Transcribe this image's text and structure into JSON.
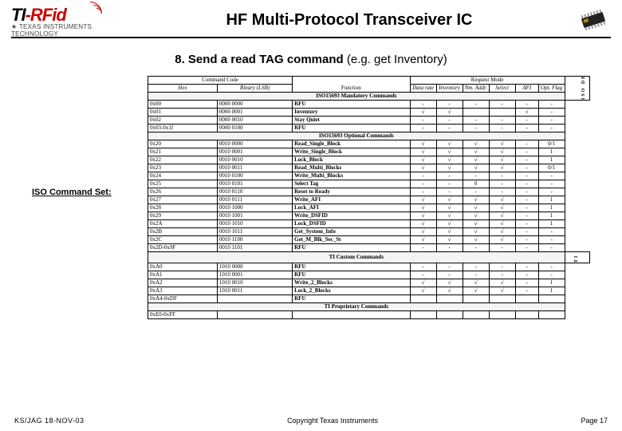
{
  "logo": {
    "ti": "TI",
    "rfid": "-RFid",
    "sub": "★ TEXAS INSTRUMENTS TECHNOLOGY"
  },
  "title": "HF Multi-Protocol Transceiver IC",
  "subtitle_bold": "8. Send a read TAG command ",
  "subtitle_norm": "(e.g. get Inventory)",
  "side_label": "ISO Command Set:",
  "headers": {
    "cmd": "Command Code",
    "func": "Function",
    "req": "Request Mode",
    "hex": "Hex",
    "bin": "Binary (LSB)",
    "dr": "Data rate",
    "inv": "Inventory",
    "addr": "Nm. Addr.",
    "sel": "Select",
    "afi": "AFI",
    "opt": "Opt. Flag"
  },
  "sections": {
    "s1": "ISO15693 Mandatory Commands",
    "s2": "ISO15693 Optional Commands",
    "s3": "TI Custom Commands",
    "s4": "TI Proprietary Commands"
  },
  "vside": {
    "a": "ISO DEFINED",
    "b": "COMMANDS",
    "c": "TI CMDS"
  },
  "rows_mand": [
    {
      "h": "0x00",
      "b": "0000 0000",
      "f": "RFU",
      "d": "-",
      "i": "-",
      "a": "-",
      "s": "-",
      "af": "-",
      "o": "-"
    },
    {
      "h": "0x01",
      "b": "0000 0001",
      "f": "Inventory",
      "d": "√",
      "i": "√",
      "a": "",
      "s": "",
      "af": "√",
      "o": "-"
    },
    {
      "h": "0x02",
      "b": "0000 0010",
      "f": "Stay Quiet",
      "d": "-",
      "i": "-",
      "a": "-",
      "s": "-",
      "af": "-",
      "o": "-"
    },
    {
      "h": "0x03-0x1f",
      "b": "0000 0100",
      "f": "RFU",
      "d": "-",
      "i": "-",
      "a": "-",
      "s": "-",
      "af": "-",
      "o": "-"
    }
  ],
  "rows_opt": [
    {
      "h": "0x20",
      "b": "0010 0000",
      "f": "Read_Single_Block",
      "d": "√",
      "i": "√",
      "a": "√",
      "s": "√",
      "af": "-",
      "o": "0/1"
    },
    {
      "h": "0x21",
      "b": "0010 0001",
      "f": "Write_Single_Block",
      "d": "√",
      "i": "√",
      "a": "√",
      "s": "√",
      "af": "-",
      "o": "1"
    },
    {
      "h": "0x22",
      "b": "0010 0010",
      "f": "Lock_Block",
      "d": "√",
      "i": "√",
      "a": "√",
      "s": "√",
      "af": "-",
      "o": "1"
    },
    {
      "h": "0x23",
      "b": "0010 0011",
      "f": "Read_Multi_Blocks",
      "d": "√",
      "i": "√",
      "a": "√",
      "s": "√",
      "af": "-",
      "o": "0/1"
    },
    {
      "h": "0x24",
      "b": "0010 0100",
      "f": "Write_Multi_Blocks",
      "d": "-",
      "i": "-",
      "a": "-",
      "s": "-",
      "af": "-",
      "o": "-"
    },
    {
      "h": "0x25",
      "b": "0010 0101",
      "f": "Select Tag",
      "d": "-",
      "i": "-",
      "a": "0",
      "s": "-",
      "af": "-",
      "o": "-"
    },
    {
      "h": "0x26",
      "b": "0010 0110",
      "f": "Reset to Ready",
      "d": "-",
      "i": "-",
      "a": "-",
      "s": "-",
      "af": "-",
      "o": "-"
    },
    {
      "h": "0x27",
      "b": "0010 0111",
      "f": "Write_AFI",
      "d": "√",
      "i": "√",
      "a": "√",
      "s": "√",
      "af": "-",
      "o": "1"
    },
    {
      "h": "0x28",
      "b": "0010 1000",
      "f": "Lock_AFI",
      "d": "√",
      "i": "√",
      "a": "√",
      "s": "√",
      "af": "-",
      "o": "1"
    },
    {
      "h": "0x29",
      "b": "0010 1001",
      "f": "Write_DSFID",
      "d": "√",
      "i": "√",
      "a": "√",
      "s": "√",
      "af": "-",
      "o": "1"
    },
    {
      "h": "0x2A",
      "b": "0010 1010",
      "f": "Lock_DSFID",
      "d": "√",
      "i": "√",
      "a": "√",
      "s": "√",
      "af": "-",
      "o": "1"
    },
    {
      "h": "0x2B",
      "b": "0010 1011",
      "f": "Get_System_Info",
      "d": "√",
      "i": "√",
      "a": "√",
      "s": "√",
      "af": "-",
      "o": "-"
    },
    {
      "h": "0x2C",
      "b": "0010 1100",
      "f": "Get_M_Blk_Sec_St",
      "d": "√",
      "i": "√",
      "a": "√",
      "s": "√",
      "af": "-",
      "o": "-"
    },
    {
      "h": "0x2D-0x9F",
      "b": "0010 1101",
      "f": "RFU",
      "d": "-",
      "i": "-",
      "a": "-",
      "s": "-",
      "af": "-",
      "o": "-"
    }
  ],
  "rows_cust": [
    {
      "h": "0xA0",
      "b": "1010 0000",
      "f": "RFU",
      "d": "-",
      "i": "-",
      "a": "-",
      "s": "-",
      "af": "-",
      "o": "-"
    },
    {
      "h": "0xA1",
      "b": "1010 0001",
      "f": "RFU",
      "d": "-",
      "i": "-",
      "a": "-",
      "s": "-",
      "af": "-",
      "o": "-"
    },
    {
      "h": "0xA2",
      "b": "1010 0010",
      "f": "Write_2_Blocks",
      "d": "√",
      "i": "√",
      "a": "√",
      "s": "√",
      "af": "-",
      "o": "1"
    },
    {
      "h": "0xA3",
      "b": "1010 0011",
      "f": "Lock_2_Blocks",
      "d": "√",
      "i": "√",
      "a": "√",
      "s": "√",
      "af": "-",
      "o": "1"
    },
    {
      "h": "0xA4-0xDF",
      "b": "",
      "f": "RFU",
      "d": "",
      "i": "",
      "a": "",
      "s": "",
      "af": "",
      "o": ""
    }
  ],
  "rows_prop": [
    {
      "h": "0xE0-0xFF",
      "b": "",
      "f": "",
      "d": "",
      "i": "",
      "a": "",
      "s": "",
      "af": "",
      "o": ""
    }
  ],
  "footer": {
    "left": "KS/JAG 18-NOV-03",
    "mid": "Copyright Texas Instruments",
    "right": "Page 17"
  }
}
